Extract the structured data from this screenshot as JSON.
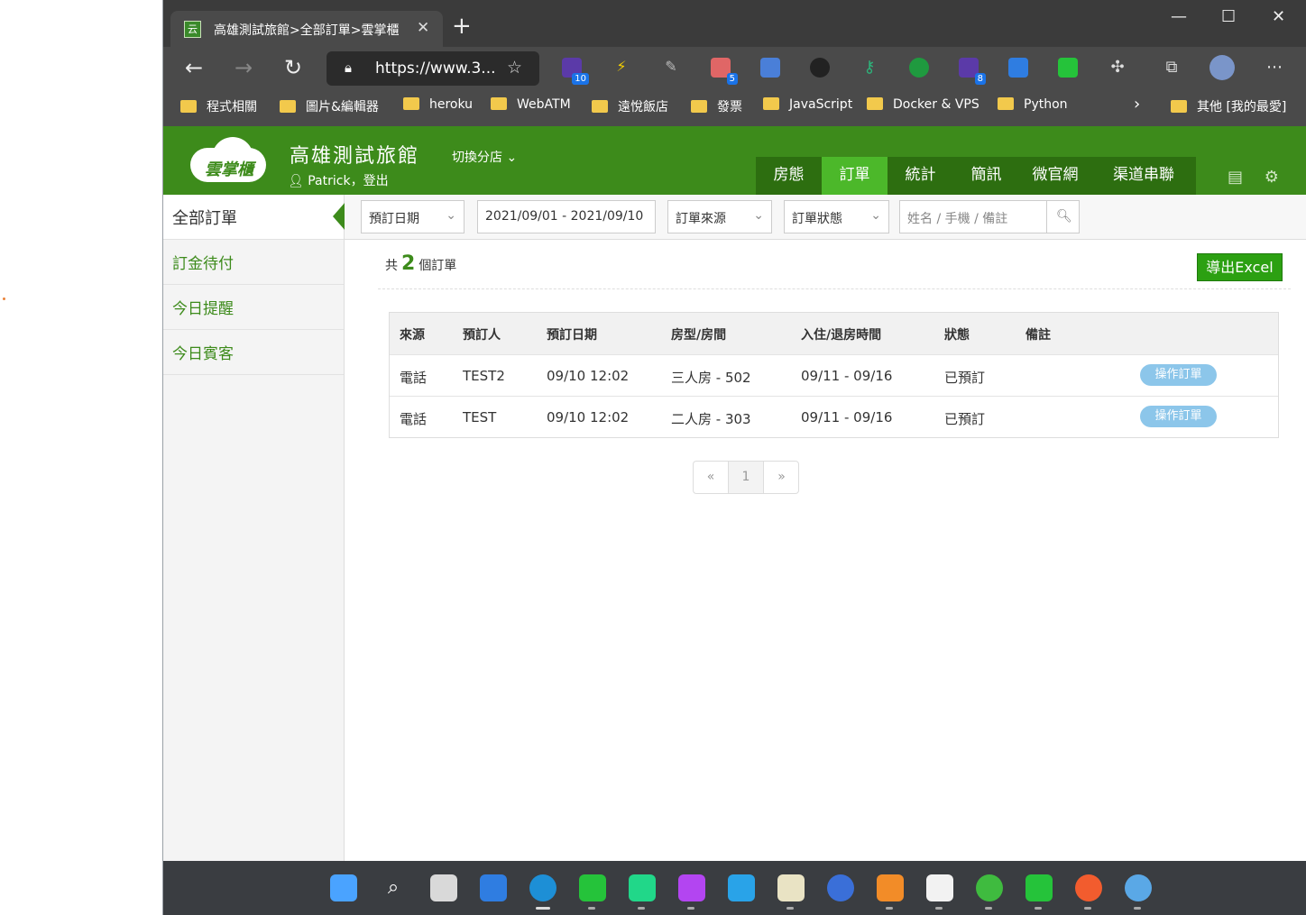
{
  "browser": {
    "tab_title": "高雄測試旅館>全部訂單>雲掌櫃",
    "tab_favicon_text": "云",
    "tab_close": "✕",
    "new_tab": "+",
    "window_controls": {
      "minimize": "—",
      "maximize": "☐",
      "close": "✕"
    },
    "url": "https://www.3...",
    "extension_badges": {
      "ext1": "10",
      "ext4": "5",
      "ext8": "8"
    },
    "bookmarks": [
      "程式相關",
      "圖片&編輯器",
      "heroku",
      "WebATM",
      "遠悅飯店",
      "發票",
      "JavaScript",
      "Docker & VPS",
      "Python"
    ],
    "bookmarks_more": "其他 [我的最愛]",
    "bookmarks_overflow": "›"
  },
  "app": {
    "logo_text": "雲掌櫃",
    "hotel_name": "高雄測試旅館",
    "user_name": "Patrick",
    "user_sep": "，",
    "logout": "登出",
    "switch_store": "切換分店",
    "nav": [
      "房態",
      "訂單",
      "統計",
      "簡訊",
      "微官網",
      "渠道串聯"
    ],
    "nav_active": "訂單"
  },
  "sidebar": {
    "items": [
      "全部訂單",
      "訂金待付",
      "今日提醒",
      "今日賓客"
    ],
    "active": "全部訂單"
  },
  "filters": {
    "date_type": "預訂日期",
    "date_range": "2021/09/01 - 2021/09/10",
    "source": "訂單來源",
    "status": "訂單狀態",
    "search_placeholder": "姓名 / 手機 / 備註"
  },
  "summary": {
    "prefix": "共",
    "count": "2",
    "suffix": "個訂單",
    "export_label": "導出Excel"
  },
  "table": {
    "headers": [
      "來源",
      "預訂人",
      "預訂日期",
      "房型/房間",
      "入住/退房時間",
      "狀態",
      "備註"
    ],
    "rows": [
      {
        "source": "電話",
        "guest": "TEST2",
        "booked": "09/10 12:02",
        "room": "三人房 - 502",
        "stay": "09/11 - 09/16",
        "status": "已預訂",
        "note": "",
        "action": "操作訂單"
      },
      {
        "source": "電話",
        "guest": "TEST",
        "booked": "09/10 12:02",
        "room": "二人房 - 303",
        "stay": "09/11 - 09/16",
        "status": "已預訂",
        "note": "",
        "action": "操作訂單"
      }
    ]
  },
  "pagination": {
    "prev": "«",
    "current": "1",
    "next": "»"
  },
  "taskbar": {
    "apps": [
      "windows-start",
      "search",
      "task-view",
      "widgets",
      "edge",
      "line",
      "pycharm",
      "phpstorm",
      "onenote",
      "app-e",
      "app-rings",
      "sublime",
      "notepad",
      "wechat",
      "line-2",
      "app-orange",
      "paint"
    ]
  },
  "colors": {
    "brand_green": "#3d8b1b",
    "nav_active": "#4cb82a",
    "export_green": "#2ca012",
    "action_blue": "#8cc6ea"
  }
}
